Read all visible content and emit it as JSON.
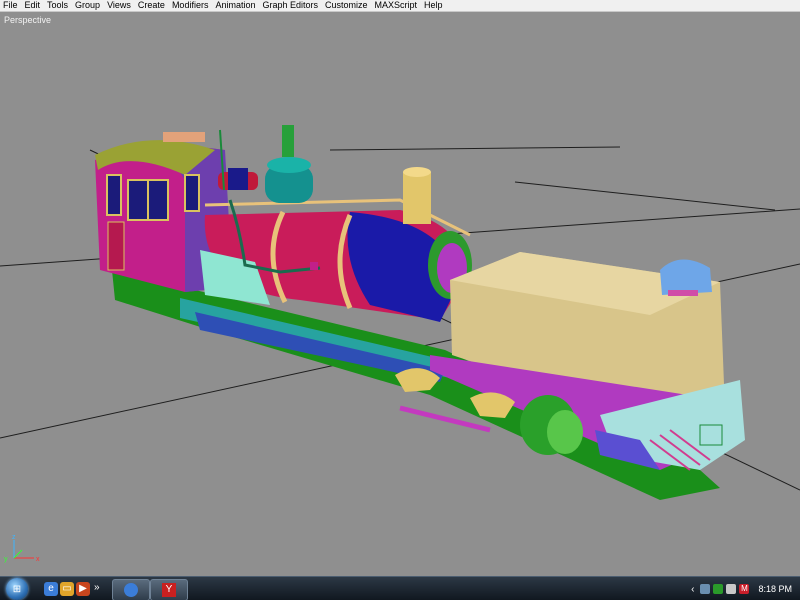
{
  "menubar": {
    "items": [
      "File",
      "Edit",
      "Tools",
      "Group",
      "Views",
      "Create",
      "Modifiers",
      "Animation",
      "Graph Editors",
      "Customize",
      "MAXScript",
      "Help"
    ]
  },
  "viewport": {
    "label": "Perspective",
    "background_color": "#8f8f8f",
    "grid_color": "#1e1e1e"
  },
  "axis_gizmo": {
    "x": "x",
    "y": "y",
    "z": "z"
  },
  "taskbar": {
    "overflow_chevron": "»",
    "tray_expand": "‹",
    "clock": "8:18 PM",
    "icons": [
      "start-orb-icon",
      "ie-icon",
      "folder-icon",
      "media-icon",
      "app-icon"
    ]
  }
}
